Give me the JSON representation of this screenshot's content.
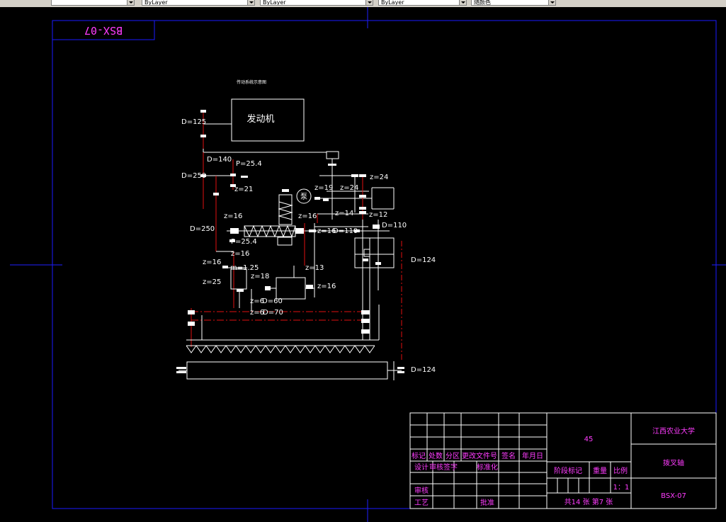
{
  "toolbar": {
    "layer_combo": "",
    "color_combo": "ByLayer",
    "linetype_combo": "ByLayer",
    "lineweight_combo": "ByLayer",
    "plotstyle_combo": "随颜色"
  },
  "drawing": {
    "mirrored_code": "BSX-07",
    "title_small": "传动系统示意图",
    "engine_label": "发动机",
    "pump_label": "泵",
    "labels": {
      "d125": "D=125",
      "d140": "D=140",
      "p254_top": "P=25.4",
      "d250_top": "D=250",
      "z21": "z=21",
      "z19": "z=19",
      "z24a": "z=24",
      "z24b": "z=24",
      "z16_a": "z=16",
      "z16_b": "z=16",
      "z14": "z=14",
      "z12": "z=12",
      "d250_mid": "D=250",
      "z16_c": "z=16",
      "d110_a": "D=110",
      "d110_b": "D=110",
      "p254_mid": "P=25.4",
      "z16_d": "z=16",
      "z16_e": "z=16",
      "m125": "m=1.25",
      "z13": "z=13",
      "d124_a": "D=124",
      "z25": "z=25",
      "z18": "z=18",
      "z16_f": "z=16",
      "z6_a": "z=6",
      "d60": "D=60",
      "z6_b": "z=6",
      "d70": "D=70",
      "d124_b": "D=124"
    }
  },
  "title_block": {
    "material": "45",
    "school": "江西农业大学",
    "part_name": "拨叉轴",
    "drawing_code": "BSX-07",
    "rev_headers": [
      "标记",
      "处数",
      "分区",
      "更改文件号",
      "签名",
      "年月日"
    ],
    "row_design": "设计",
    "row_design_sig": "审核签字",
    "row_standard": "标准化",
    "row_review": "审核",
    "row_process": "工艺",
    "row_approve": "批准",
    "stage_label": "阶段标记",
    "weight_label": "重量",
    "scale_label": "比例",
    "scale_value": "1：1",
    "sheet_info": "共14 张 第7 张"
  },
  "colors": {
    "frame_blue": "#1a1aff",
    "line_white": "#ffffff",
    "centerline_red": "#e01010",
    "title_magenta": "#ff3cff"
  }
}
